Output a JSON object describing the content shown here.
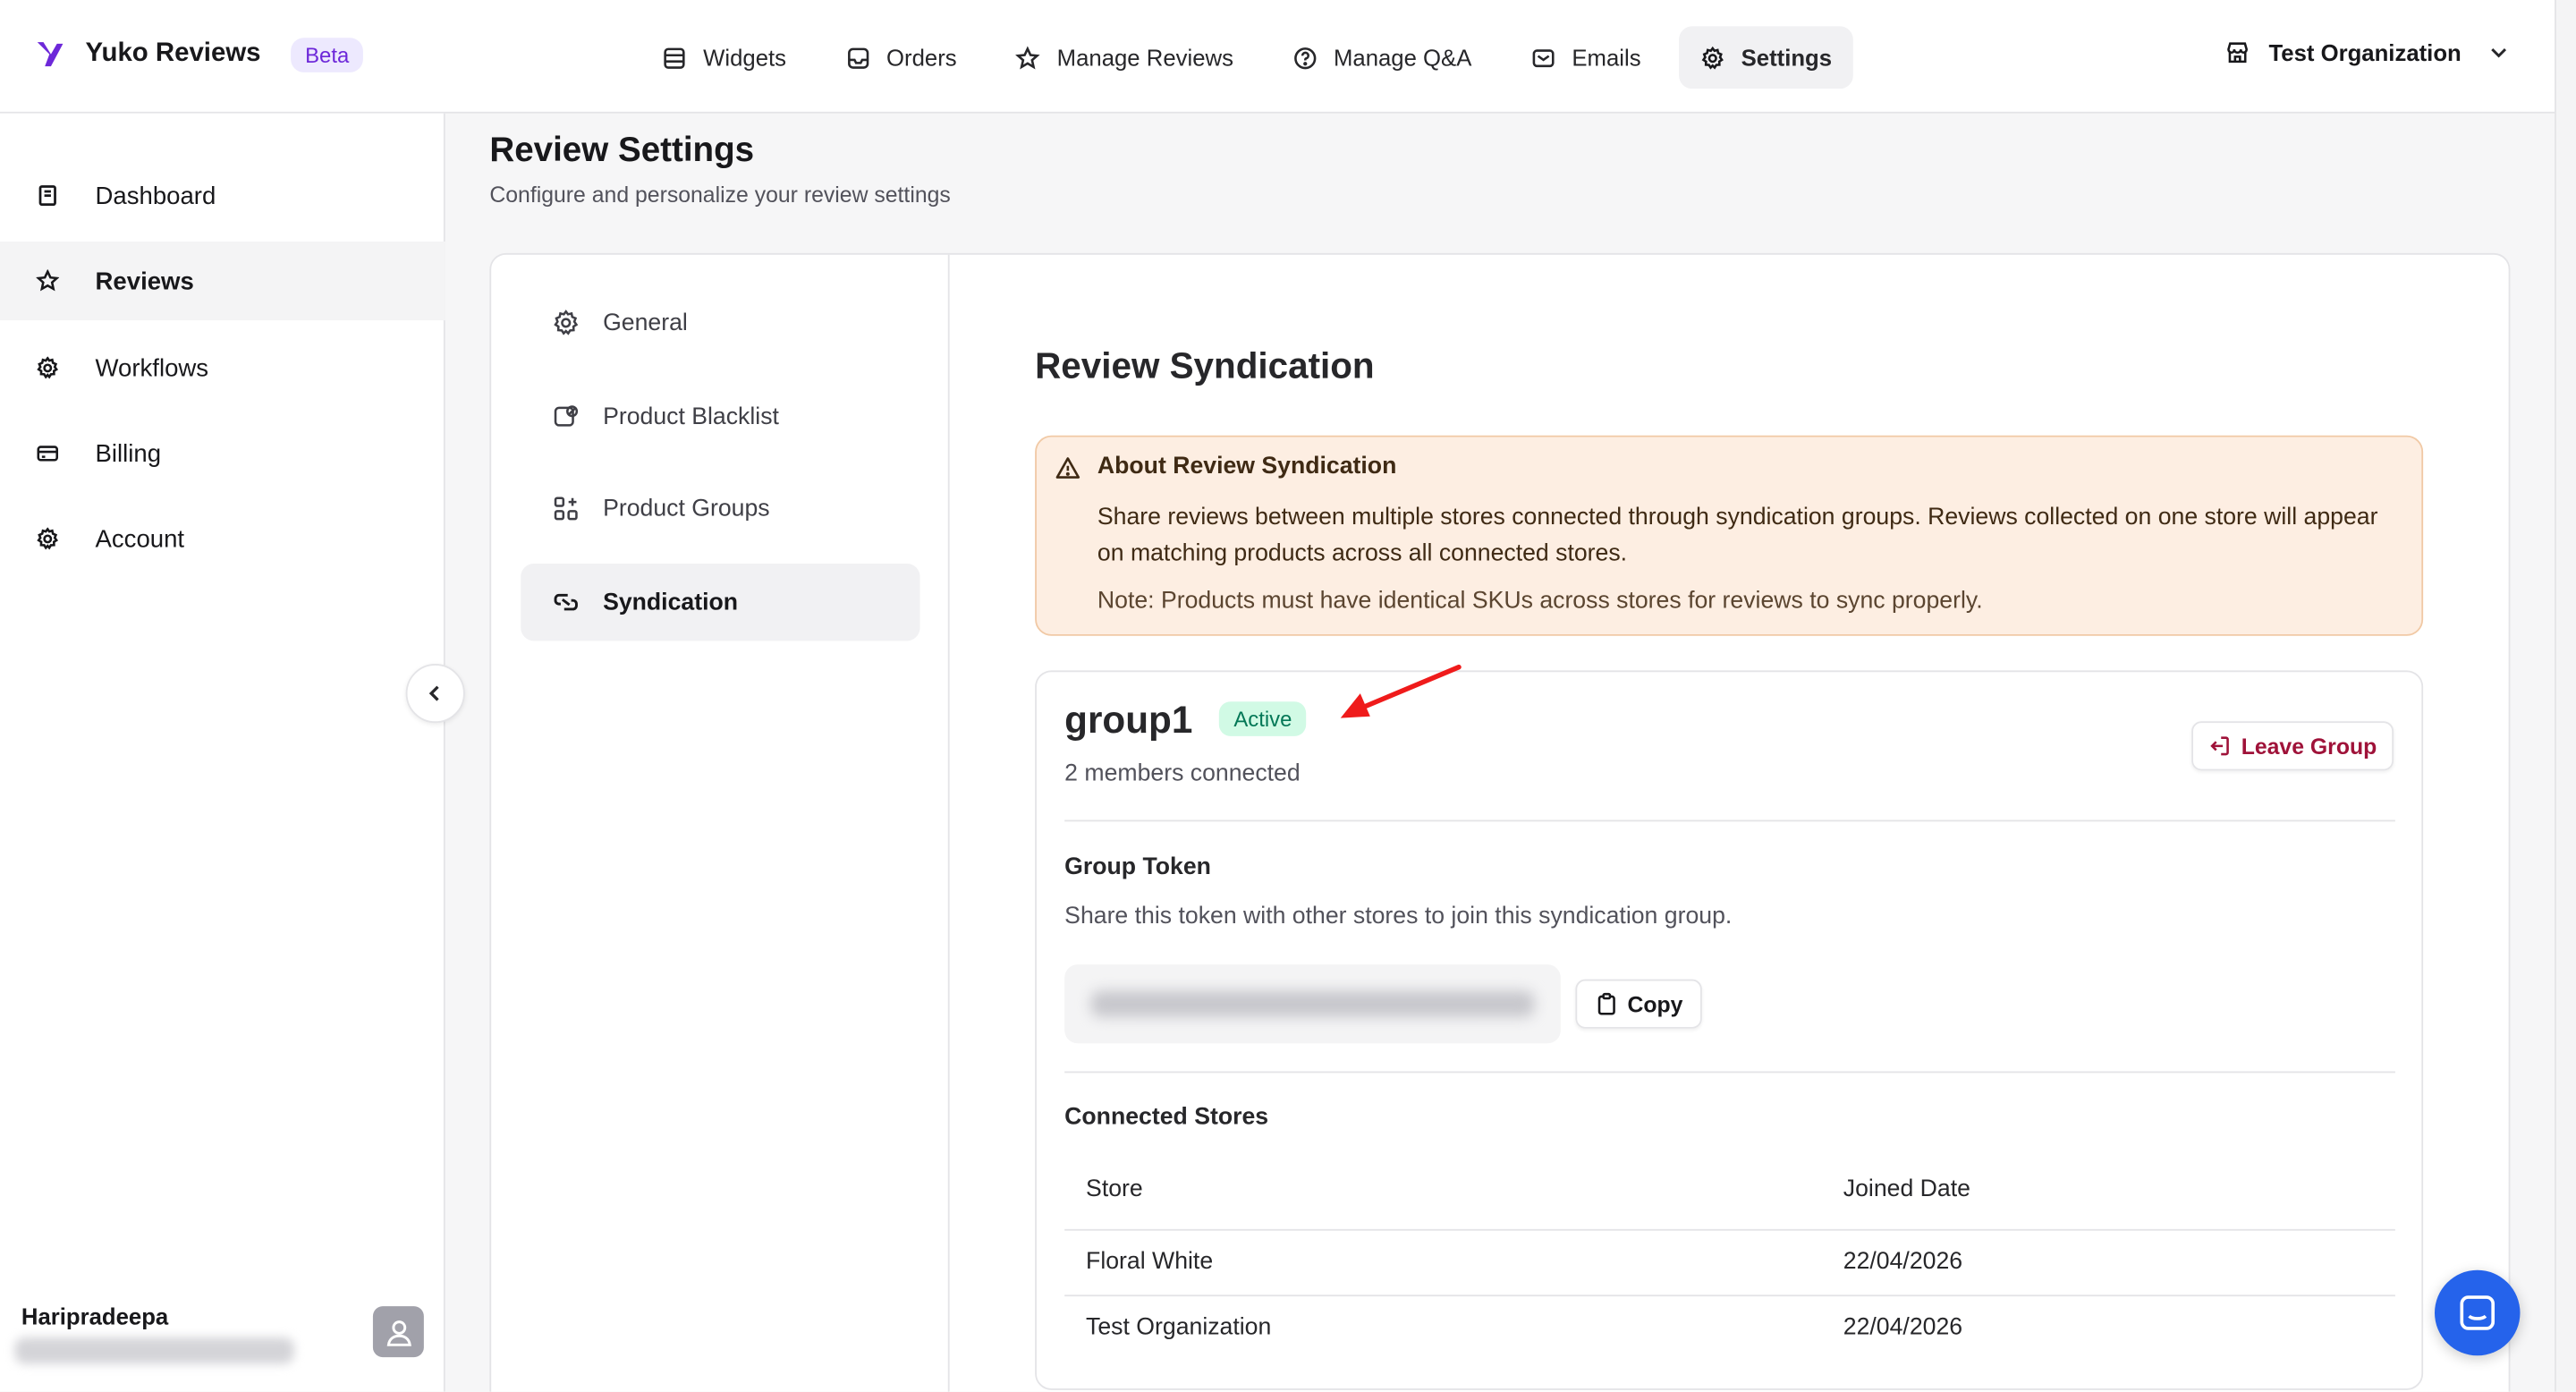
{
  "app": {
    "name": "Yuko Reviews",
    "badge": "Beta"
  },
  "nav": [
    {
      "label": "Widgets",
      "icon": "widgets-icon"
    },
    {
      "label": "Orders",
      "icon": "inbox-icon"
    },
    {
      "label": "Manage Reviews",
      "icon": "star-icon"
    },
    {
      "label": "Manage Q&A",
      "icon": "question-icon"
    },
    {
      "label": "Emails",
      "icon": "mail-icon"
    },
    {
      "label": "Settings",
      "icon": "gear-icon",
      "active": true
    }
  ],
  "org": {
    "name": "Test Organization"
  },
  "sidebar": {
    "items": [
      {
        "label": "Dashboard"
      },
      {
        "label": "Reviews",
        "active": true
      },
      {
        "label": "Workflows"
      },
      {
        "label": "Billing"
      },
      {
        "label": "Account"
      }
    ],
    "user": {
      "name": "Haripradeepa"
    }
  },
  "page": {
    "title": "Review Settings",
    "subtitle": "Configure and personalize your review settings"
  },
  "subnav": [
    {
      "label": "General"
    },
    {
      "label": "Product Blacklist"
    },
    {
      "label": "Product Groups"
    },
    {
      "label": "Syndication",
      "active": true
    }
  ],
  "syndication": {
    "title": "Review Syndication",
    "alert": {
      "title": "About Review Syndication",
      "body": "Share reviews between multiple stores connected through syndication groups. Reviews collected on one store will appear on matching products across all connected stores.",
      "note": "Note: Products must have identical SKUs across stores for reviews to sync properly."
    },
    "group": {
      "name": "group1",
      "status": "Active",
      "members": "2 members connected",
      "leave_label": "Leave Group",
      "token_label": "Group Token",
      "token_help": "Share this token with other stores to join this syndication group.",
      "copy_label": "Copy",
      "stores_label": "Connected Stores",
      "columns": [
        "Store",
        "Joined Date"
      ],
      "rows": [
        [
          "Floral White",
          "22/04/2026"
        ],
        [
          "Test Organization",
          "22/04/2026"
        ]
      ]
    }
  },
  "colors": {
    "accent": "#6d28d9",
    "active_badge": "#047857",
    "leave": "#9f1239",
    "chat": "#2563eb",
    "annotation_arrow": "#ef1b1b"
  }
}
